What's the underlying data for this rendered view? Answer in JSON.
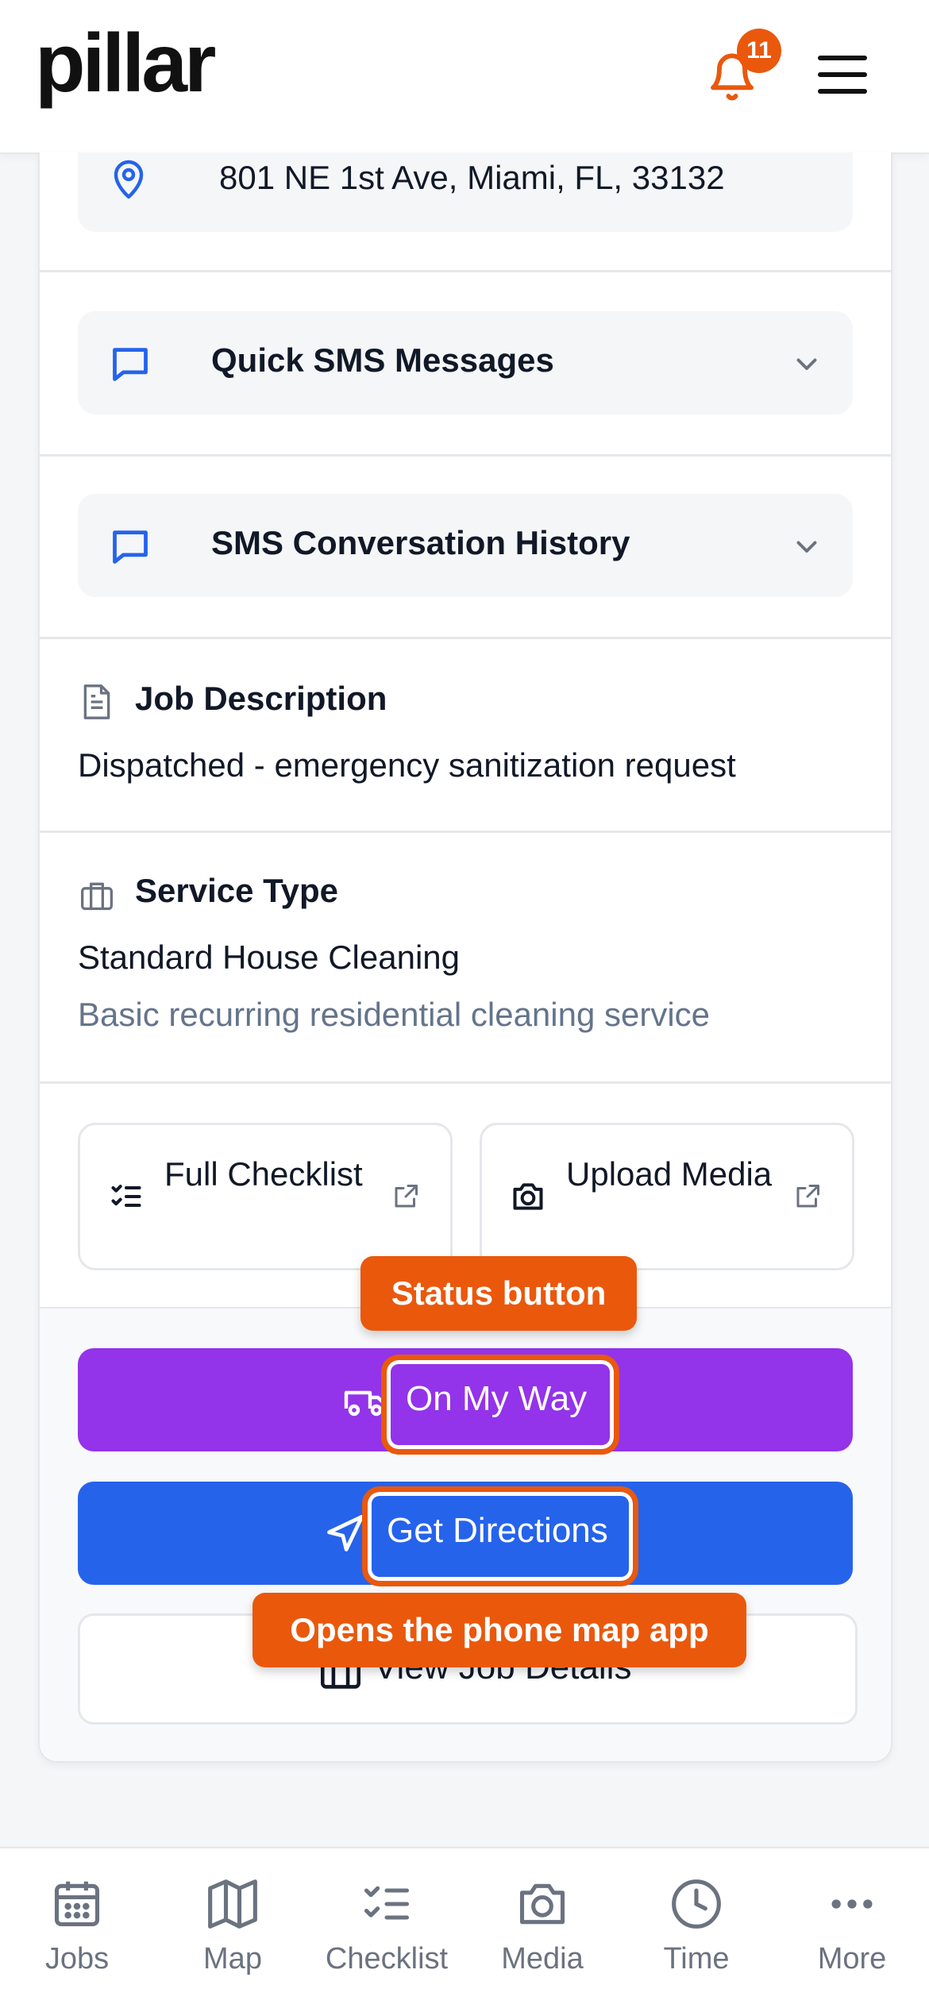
{
  "header": {
    "logo": "pillar",
    "notification_count": "11",
    "menu_icon": "hamburger-icon",
    "bell_icon": "bell-icon"
  },
  "job": {
    "address": "801 NE 1st Ave, Miami, FL, 33132",
    "quick_sms_label": "Quick SMS Messages",
    "sms_history_label": "SMS Conversation History",
    "description_title": "Job Description",
    "description_text": "Dispatched - emergency sanitization request",
    "service_type_title": "Service Type",
    "service_name": "Standard House Cleaning",
    "service_desc": "Basic recurring residential cleaning service"
  },
  "tiles": {
    "checklist_label": "Full Checklist",
    "media_label": "Upload Media"
  },
  "actions": {
    "on_my_way": "On My Way",
    "get_directions": "Get Directions",
    "view_details": "View Job Details"
  },
  "callouts": {
    "status": "Status button",
    "map": "Opens the phone map app"
  },
  "nav": {
    "items": [
      {
        "label": "Jobs",
        "icon": "calendar-icon"
      },
      {
        "label": "Map",
        "icon": "map-icon"
      },
      {
        "label": "Checklist",
        "icon": "checklist-icon"
      },
      {
        "label": "Media",
        "icon": "camera-icon"
      },
      {
        "label": "Time",
        "icon": "clock-icon"
      },
      {
        "label": "More",
        "icon": "more-icon"
      }
    ]
  },
  "colors": {
    "accent_blue": "#2563eb",
    "purple": "#9333ea",
    "orange": "#ea580c"
  }
}
